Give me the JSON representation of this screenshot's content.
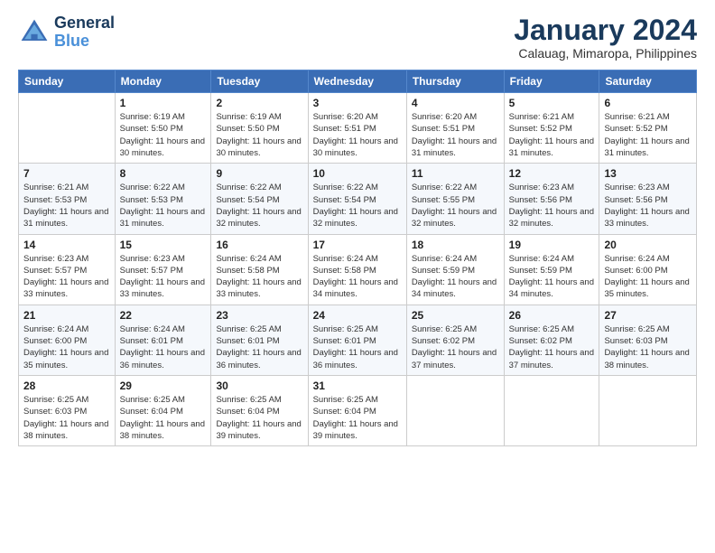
{
  "logo": {
    "line1": "General",
    "line2": "Blue"
  },
  "title": "January 2024",
  "location": "Calauag, Mimaropa, Philippines",
  "header": {
    "days": [
      "Sunday",
      "Monday",
      "Tuesday",
      "Wednesday",
      "Thursday",
      "Friday",
      "Saturday"
    ]
  },
  "weeks": [
    [
      {
        "day": "",
        "sunrise": "",
        "sunset": "",
        "daylight": ""
      },
      {
        "day": "1",
        "sunrise": "Sunrise: 6:19 AM",
        "sunset": "Sunset: 5:50 PM",
        "daylight": "Daylight: 11 hours and 30 minutes."
      },
      {
        "day": "2",
        "sunrise": "Sunrise: 6:19 AM",
        "sunset": "Sunset: 5:50 PM",
        "daylight": "Daylight: 11 hours and 30 minutes."
      },
      {
        "day": "3",
        "sunrise": "Sunrise: 6:20 AM",
        "sunset": "Sunset: 5:51 PM",
        "daylight": "Daylight: 11 hours and 30 minutes."
      },
      {
        "day": "4",
        "sunrise": "Sunrise: 6:20 AM",
        "sunset": "Sunset: 5:51 PM",
        "daylight": "Daylight: 11 hours and 31 minutes."
      },
      {
        "day": "5",
        "sunrise": "Sunrise: 6:21 AM",
        "sunset": "Sunset: 5:52 PM",
        "daylight": "Daylight: 11 hours and 31 minutes."
      },
      {
        "day": "6",
        "sunrise": "Sunrise: 6:21 AM",
        "sunset": "Sunset: 5:52 PM",
        "daylight": "Daylight: 11 hours and 31 minutes."
      }
    ],
    [
      {
        "day": "7",
        "sunrise": "Sunrise: 6:21 AM",
        "sunset": "Sunset: 5:53 PM",
        "daylight": "Daylight: 11 hours and 31 minutes."
      },
      {
        "day": "8",
        "sunrise": "Sunrise: 6:22 AM",
        "sunset": "Sunset: 5:53 PM",
        "daylight": "Daylight: 11 hours and 31 minutes."
      },
      {
        "day": "9",
        "sunrise": "Sunrise: 6:22 AM",
        "sunset": "Sunset: 5:54 PM",
        "daylight": "Daylight: 11 hours and 32 minutes."
      },
      {
        "day": "10",
        "sunrise": "Sunrise: 6:22 AM",
        "sunset": "Sunset: 5:54 PM",
        "daylight": "Daylight: 11 hours and 32 minutes."
      },
      {
        "day": "11",
        "sunrise": "Sunrise: 6:22 AM",
        "sunset": "Sunset: 5:55 PM",
        "daylight": "Daylight: 11 hours and 32 minutes."
      },
      {
        "day": "12",
        "sunrise": "Sunrise: 6:23 AM",
        "sunset": "Sunset: 5:56 PM",
        "daylight": "Daylight: 11 hours and 32 minutes."
      },
      {
        "day": "13",
        "sunrise": "Sunrise: 6:23 AM",
        "sunset": "Sunset: 5:56 PM",
        "daylight": "Daylight: 11 hours and 33 minutes."
      }
    ],
    [
      {
        "day": "14",
        "sunrise": "Sunrise: 6:23 AM",
        "sunset": "Sunset: 5:57 PM",
        "daylight": "Daylight: 11 hours and 33 minutes."
      },
      {
        "day": "15",
        "sunrise": "Sunrise: 6:23 AM",
        "sunset": "Sunset: 5:57 PM",
        "daylight": "Daylight: 11 hours and 33 minutes."
      },
      {
        "day": "16",
        "sunrise": "Sunrise: 6:24 AM",
        "sunset": "Sunset: 5:58 PM",
        "daylight": "Daylight: 11 hours and 33 minutes."
      },
      {
        "day": "17",
        "sunrise": "Sunrise: 6:24 AM",
        "sunset": "Sunset: 5:58 PM",
        "daylight": "Daylight: 11 hours and 34 minutes."
      },
      {
        "day": "18",
        "sunrise": "Sunrise: 6:24 AM",
        "sunset": "Sunset: 5:59 PM",
        "daylight": "Daylight: 11 hours and 34 minutes."
      },
      {
        "day": "19",
        "sunrise": "Sunrise: 6:24 AM",
        "sunset": "Sunset: 5:59 PM",
        "daylight": "Daylight: 11 hours and 34 minutes."
      },
      {
        "day": "20",
        "sunrise": "Sunrise: 6:24 AM",
        "sunset": "Sunset: 6:00 PM",
        "daylight": "Daylight: 11 hours and 35 minutes."
      }
    ],
    [
      {
        "day": "21",
        "sunrise": "Sunrise: 6:24 AM",
        "sunset": "Sunset: 6:00 PM",
        "daylight": "Daylight: 11 hours and 35 minutes."
      },
      {
        "day": "22",
        "sunrise": "Sunrise: 6:24 AM",
        "sunset": "Sunset: 6:01 PM",
        "daylight": "Daylight: 11 hours and 36 minutes."
      },
      {
        "day": "23",
        "sunrise": "Sunrise: 6:25 AM",
        "sunset": "Sunset: 6:01 PM",
        "daylight": "Daylight: 11 hours and 36 minutes."
      },
      {
        "day": "24",
        "sunrise": "Sunrise: 6:25 AM",
        "sunset": "Sunset: 6:01 PM",
        "daylight": "Daylight: 11 hours and 36 minutes."
      },
      {
        "day": "25",
        "sunrise": "Sunrise: 6:25 AM",
        "sunset": "Sunset: 6:02 PM",
        "daylight": "Daylight: 11 hours and 37 minutes."
      },
      {
        "day": "26",
        "sunrise": "Sunrise: 6:25 AM",
        "sunset": "Sunset: 6:02 PM",
        "daylight": "Daylight: 11 hours and 37 minutes."
      },
      {
        "day": "27",
        "sunrise": "Sunrise: 6:25 AM",
        "sunset": "Sunset: 6:03 PM",
        "daylight": "Daylight: 11 hours and 38 minutes."
      }
    ],
    [
      {
        "day": "28",
        "sunrise": "Sunrise: 6:25 AM",
        "sunset": "Sunset: 6:03 PM",
        "daylight": "Daylight: 11 hours and 38 minutes."
      },
      {
        "day": "29",
        "sunrise": "Sunrise: 6:25 AM",
        "sunset": "Sunset: 6:04 PM",
        "daylight": "Daylight: 11 hours and 38 minutes."
      },
      {
        "day": "30",
        "sunrise": "Sunrise: 6:25 AM",
        "sunset": "Sunset: 6:04 PM",
        "daylight": "Daylight: 11 hours and 39 minutes."
      },
      {
        "day": "31",
        "sunrise": "Sunrise: 6:25 AM",
        "sunset": "Sunset: 6:04 PM",
        "daylight": "Daylight: 11 hours and 39 minutes."
      },
      {
        "day": "",
        "sunrise": "",
        "sunset": "",
        "daylight": ""
      },
      {
        "day": "",
        "sunrise": "",
        "sunset": "",
        "daylight": ""
      },
      {
        "day": "",
        "sunrise": "",
        "sunset": "",
        "daylight": ""
      }
    ]
  ]
}
